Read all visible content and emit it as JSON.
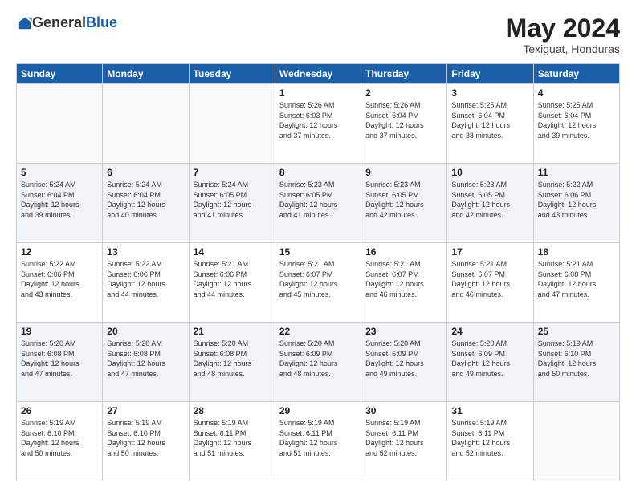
{
  "logo": {
    "general": "General",
    "blue": "Blue"
  },
  "title": "May 2024",
  "location": "Texiguat, Honduras",
  "days_header": [
    "Sunday",
    "Monday",
    "Tuesday",
    "Wednesday",
    "Thursday",
    "Friday",
    "Saturday"
  ],
  "weeks": [
    [
      {
        "day": "",
        "info": ""
      },
      {
        "day": "",
        "info": ""
      },
      {
        "day": "",
        "info": ""
      },
      {
        "day": "1",
        "info": "Sunrise: 5:26 AM\nSunset: 6:03 PM\nDaylight: 12 hours\nand 37 minutes."
      },
      {
        "day": "2",
        "info": "Sunrise: 5:26 AM\nSunset: 6:04 PM\nDaylight: 12 hours\nand 37 minutes."
      },
      {
        "day": "3",
        "info": "Sunrise: 5:25 AM\nSunset: 6:04 PM\nDaylight: 12 hours\nand 38 minutes."
      },
      {
        "day": "4",
        "info": "Sunrise: 5:25 AM\nSunset: 6:04 PM\nDaylight: 12 hours\nand 39 minutes."
      }
    ],
    [
      {
        "day": "5",
        "info": "Sunrise: 5:24 AM\nSunset: 6:04 PM\nDaylight: 12 hours\nand 39 minutes."
      },
      {
        "day": "6",
        "info": "Sunrise: 5:24 AM\nSunset: 6:04 PM\nDaylight: 12 hours\nand 40 minutes."
      },
      {
        "day": "7",
        "info": "Sunrise: 5:24 AM\nSunset: 6:05 PM\nDaylight: 12 hours\nand 41 minutes."
      },
      {
        "day": "8",
        "info": "Sunrise: 5:23 AM\nSunset: 6:05 PM\nDaylight: 12 hours\nand 41 minutes."
      },
      {
        "day": "9",
        "info": "Sunrise: 5:23 AM\nSunset: 6:05 PM\nDaylight: 12 hours\nand 42 minutes."
      },
      {
        "day": "10",
        "info": "Sunrise: 5:23 AM\nSunset: 6:05 PM\nDaylight: 12 hours\nand 42 minutes."
      },
      {
        "day": "11",
        "info": "Sunrise: 5:22 AM\nSunset: 6:06 PM\nDaylight: 12 hours\nand 43 minutes."
      }
    ],
    [
      {
        "day": "12",
        "info": "Sunrise: 5:22 AM\nSunset: 6:06 PM\nDaylight: 12 hours\nand 43 minutes."
      },
      {
        "day": "13",
        "info": "Sunrise: 5:22 AM\nSunset: 6:06 PM\nDaylight: 12 hours\nand 44 minutes."
      },
      {
        "day": "14",
        "info": "Sunrise: 5:21 AM\nSunset: 6:06 PM\nDaylight: 12 hours\nand 44 minutes."
      },
      {
        "day": "15",
        "info": "Sunrise: 5:21 AM\nSunset: 6:07 PM\nDaylight: 12 hours\nand 45 minutes."
      },
      {
        "day": "16",
        "info": "Sunrise: 5:21 AM\nSunset: 6:07 PM\nDaylight: 12 hours\nand 46 minutes."
      },
      {
        "day": "17",
        "info": "Sunrise: 5:21 AM\nSunset: 6:07 PM\nDaylight: 12 hours\nand 46 minutes."
      },
      {
        "day": "18",
        "info": "Sunrise: 5:21 AM\nSunset: 6:08 PM\nDaylight: 12 hours\nand 47 minutes."
      }
    ],
    [
      {
        "day": "19",
        "info": "Sunrise: 5:20 AM\nSunset: 6:08 PM\nDaylight: 12 hours\nand 47 minutes."
      },
      {
        "day": "20",
        "info": "Sunrise: 5:20 AM\nSunset: 6:08 PM\nDaylight: 12 hours\nand 47 minutes."
      },
      {
        "day": "21",
        "info": "Sunrise: 5:20 AM\nSunset: 6:08 PM\nDaylight: 12 hours\nand 48 minutes."
      },
      {
        "day": "22",
        "info": "Sunrise: 5:20 AM\nSunset: 6:09 PM\nDaylight: 12 hours\nand 48 minutes."
      },
      {
        "day": "23",
        "info": "Sunrise: 5:20 AM\nSunset: 6:09 PM\nDaylight: 12 hours\nand 49 minutes."
      },
      {
        "day": "24",
        "info": "Sunrise: 5:20 AM\nSunset: 6:09 PM\nDaylight: 12 hours\nand 49 minutes."
      },
      {
        "day": "25",
        "info": "Sunrise: 5:19 AM\nSunset: 6:10 PM\nDaylight: 12 hours\nand 50 minutes."
      }
    ],
    [
      {
        "day": "26",
        "info": "Sunrise: 5:19 AM\nSunset: 6:10 PM\nDaylight: 12 hours\nand 50 minutes."
      },
      {
        "day": "27",
        "info": "Sunrise: 5:19 AM\nSunset: 6:10 PM\nDaylight: 12 hours\nand 50 minutes."
      },
      {
        "day": "28",
        "info": "Sunrise: 5:19 AM\nSunset: 6:11 PM\nDaylight: 12 hours\nand 51 minutes."
      },
      {
        "day": "29",
        "info": "Sunrise: 5:19 AM\nSunset: 6:11 PM\nDaylight: 12 hours\nand 51 minutes."
      },
      {
        "day": "30",
        "info": "Sunrise: 5:19 AM\nSunset: 6:11 PM\nDaylight: 12 hours\nand 52 minutes."
      },
      {
        "day": "31",
        "info": "Sunrise: 5:19 AM\nSunset: 6:11 PM\nDaylight: 12 hours\nand 52 minutes."
      },
      {
        "day": "",
        "info": ""
      }
    ]
  ]
}
